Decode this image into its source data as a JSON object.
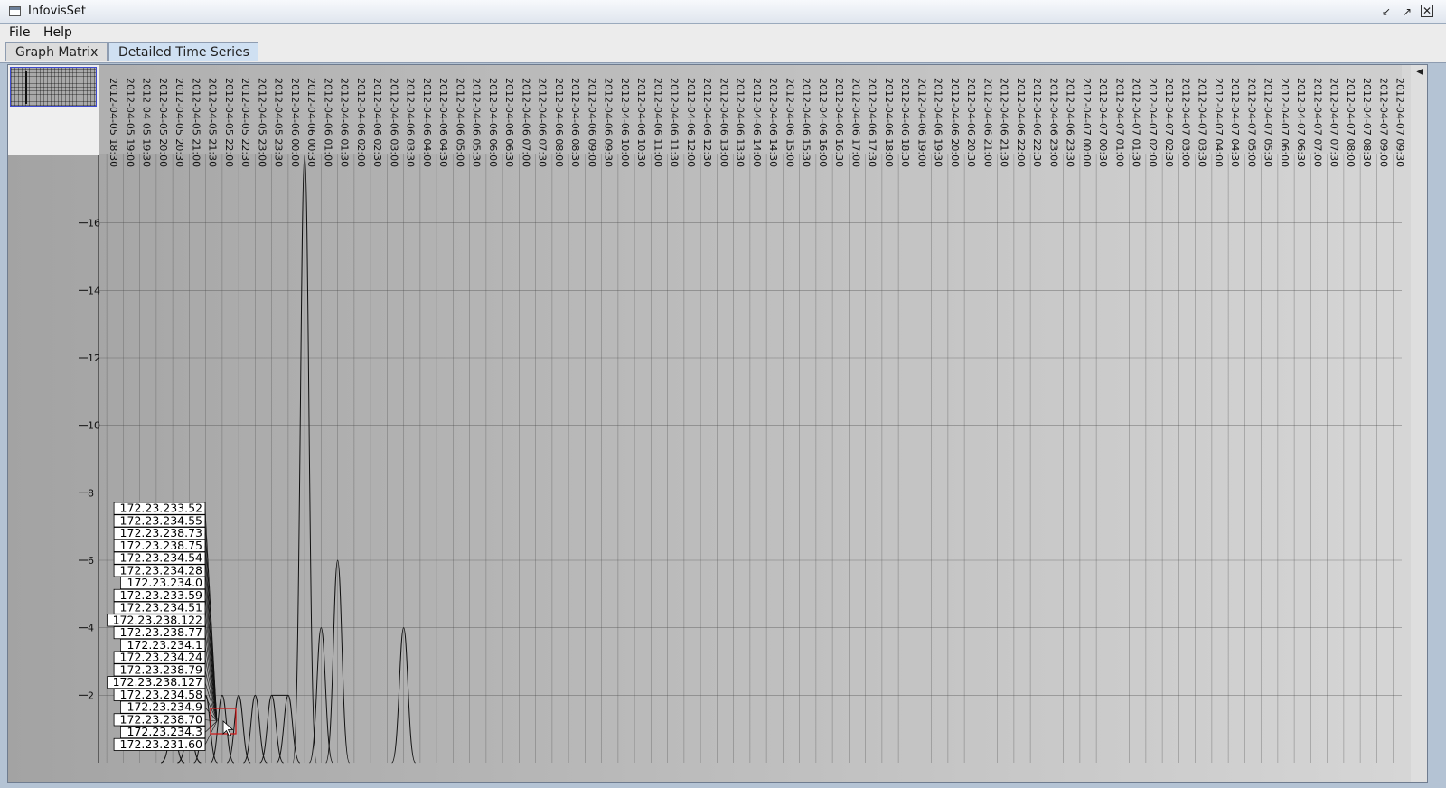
{
  "window": {
    "title": "InfovisSet",
    "icon": "window-icon",
    "controls": [
      "minimize-icon",
      "maximize-icon",
      "close-icon"
    ]
  },
  "menubar": {
    "items": [
      "File",
      "Help"
    ]
  },
  "tabs": [
    {
      "label": "Graph Matrix",
      "selected": false
    },
    {
      "label": "Detailed Time Series",
      "selected": true
    }
  ],
  "chart_data": {
    "type": "line",
    "title": "",
    "xlabel": "",
    "ylabel": "",
    "ylim": [
      0,
      18
    ],
    "y_ticks": [
      2,
      4,
      6,
      8,
      10,
      12,
      14,
      16
    ],
    "x_ticks": [
      "2012-04-05 18:30",
      "2012-04-05 19:00",
      "2012-04-05 19:30",
      "2012-04-05 20:00",
      "2012-04-05 20:30",
      "2012-04-05 21:00",
      "2012-04-05 21:30",
      "2012-04-05 22:00",
      "2012-04-05 22:30",
      "2012-04-05 23:00",
      "2012-04-05 23:30",
      "2012-04-06 00:00",
      "2012-04-06 00:30",
      "2012-04-06 01:00",
      "2012-04-06 01:30",
      "2012-04-06 02:00",
      "2012-04-06 02:30",
      "2012-04-06 03:00",
      "2012-04-06 03:30",
      "2012-04-06 04:00",
      "2012-04-06 04:30",
      "2012-04-06 05:00",
      "2012-04-06 05:30",
      "2012-04-06 06:00",
      "2012-04-06 06:30",
      "2012-04-06 07:00",
      "2012-04-06 07:30",
      "2012-04-06 08:00",
      "2012-04-06 08:30",
      "2012-04-06 09:00",
      "2012-04-06 09:30",
      "2012-04-06 10:00",
      "2012-04-06 10:30",
      "2012-04-06 11:00",
      "2012-04-06 11:30",
      "2012-04-06 12:00",
      "2012-04-06 12:30",
      "2012-04-06 13:00",
      "2012-04-06 13:30",
      "2012-04-06 14:00",
      "2012-04-06 14:30",
      "2012-04-06 15:00",
      "2012-04-06 15:30",
      "2012-04-06 16:00",
      "2012-04-06 16:30",
      "2012-04-06 17:00",
      "2012-04-06 17:30",
      "2012-04-06 18:00",
      "2012-04-06 18:30",
      "2012-04-06 19:00",
      "2012-04-06 19:30",
      "2012-04-06 20:00",
      "2012-04-06 20:30",
      "2012-04-06 21:00",
      "2012-04-06 21:30",
      "2012-04-06 22:00",
      "2012-04-06 22:30",
      "2012-04-06 23:00",
      "2012-04-06 23:30",
      "2012-04-07 00:00",
      "2012-04-07 00:30",
      "2012-04-07 01:00",
      "2012-04-07 01:30",
      "2012-04-07 02:00",
      "2012-04-07 02:30",
      "2012-04-07 03:00",
      "2012-04-07 03:30",
      "2012-04-07 04:00",
      "2012-04-07 04:30",
      "2012-04-07 05:00",
      "2012-04-07 05:30",
      "2012-04-07 06:00",
      "2012-04-07 06:30",
      "2012-04-07 07:00",
      "2012-04-07 07:30",
      "2012-04-07 08:00",
      "2012-04-07 08:30",
      "2012-04-07 09:00",
      "2012-04-07 09:30"
    ],
    "series_labels": [
      "172.23.233.52",
      "172.23.234.55",
      "172.23.238.73",
      "172.23.238.75",
      "172.23.234.54",
      "172.23.234.28",
      "172.23.234.0",
      "172.23.233.59",
      "172.23.234.51",
      "172.23.238.122",
      "172.23.238.77",
      "172.23.234.1",
      "172.23.234.24",
      "172.23.238.79",
      "172.23.238.127",
      "172.23.234.58",
      "172.23.234.9",
      "172.23.238.70",
      "172.23.234.3",
      "172.23.231.60"
    ],
    "peaks": [
      {
        "x": "2012-04-05 20:30",
        "y": 1
      },
      {
        "x": "2012-04-05 21:00",
        "y": 1
      },
      {
        "x": "2012-04-05 21:30",
        "y": 2
      },
      {
        "x": "2012-04-05 22:00",
        "y": 2
      },
      {
        "x": "2012-04-05 22:30",
        "y": 2
      },
      {
        "x": "2012-04-05 23:00",
        "y": 2
      },
      {
        "x": "2012-04-05 23:30",
        "y": 2
      },
      {
        "x": "2012-04-06 00:00",
        "y": 2
      },
      {
        "x": "2012-04-06 00:30",
        "y": 18
      },
      {
        "x": "2012-04-06 01:00",
        "y": 4
      },
      {
        "x": "2012-04-06 01:30",
        "y": 6
      },
      {
        "x": "2012-04-06 03:30",
        "y": 4
      }
    ],
    "grid": true
  }
}
